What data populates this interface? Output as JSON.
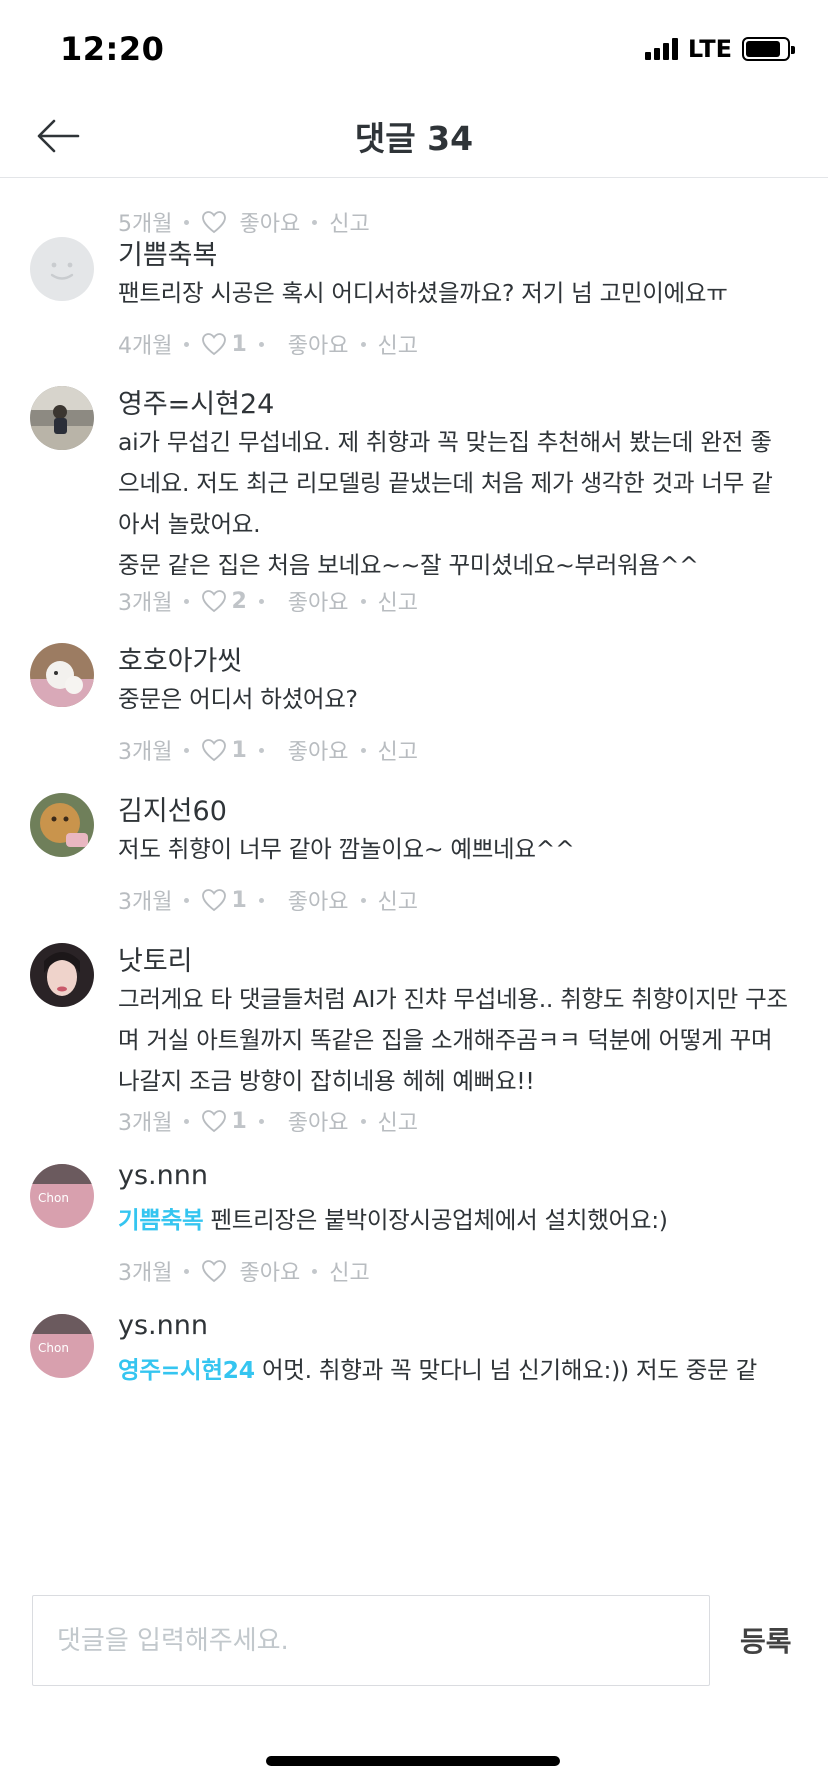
{
  "status_bar": {
    "time": "12:20",
    "network": "LTE"
  },
  "header": {
    "title": "댓글 34",
    "back_icon": "arrow-left-icon"
  },
  "labels": {
    "like": "좋아요",
    "report": "신고"
  },
  "top_meta": {
    "time": "5개월",
    "likes": ""
  },
  "comments": [
    {
      "username": "기쁨축복",
      "avatar": "default-face-avatar",
      "mention": "",
      "lines": [
        "팬트리장 시공은 혹시 어디서하셨을까요? 저기 넘 고민이에요ㅠ"
      ],
      "time": "4개월",
      "likes": "1"
    },
    {
      "username": "영주=시현24",
      "avatar": "photo-avatar",
      "mention": "",
      "lines": [
        "ai가 무섭긴 무섭네요. 제 취향과 꼭 맞는집 추천해서 봤는데 완전 좋으네요. 저도 최근 리모델링 끝냈는데 처음 제가 생각한 것과 너무 같아서 놀랐어요.",
        "중문 같은 집은 처음 보네요~~잘 꾸미셨네요~부러워욤^^"
      ],
      "time": "3개월",
      "likes": "2"
    },
    {
      "username": "호호아가씻",
      "avatar": "photo-avatar",
      "mention": "",
      "lines": [
        "중문은 어디서 하셨어요?"
      ],
      "time": "3개월",
      "likes": "1"
    },
    {
      "username": "김지선60",
      "avatar": "photo-avatar",
      "mention": "",
      "lines": [
        "저도 취향이 너무 같아 깜놀이요~ 예쁘네요^^"
      ],
      "time": "3개월",
      "likes": "1"
    },
    {
      "username": "낫토리",
      "avatar": "photo-avatar",
      "mention": "",
      "lines": [
        "그러게요 타 댓글들처럼 AI가 진챠 무섭네용.. 취향도 취향이지만 구조며 거실 아트월까지 똑같은 집을 소개해주곰ㅋㅋ 덕분에 어떻게 꾸며나갈지 조금 방향이 잡히네용 헤헤 예뻐요!!"
      ],
      "time": "3개월",
      "likes": "1"
    },
    {
      "username": "ys.nnn",
      "avatar": "photo-avatar",
      "mention": "기쁨축복",
      "lines": [
        "펜트리장은 붙박이장시공업체에서 설치했어요:)"
      ],
      "time": "3개월",
      "likes": ""
    },
    {
      "username": "ys.nnn",
      "avatar": "photo-avatar",
      "mention": "영주=시현24",
      "lines": [
        "어멋. 취향과 꼭 맞다니 넘 신기해요:)) 저도 중문 같"
      ],
      "time": "",
      "likes": ""
    }
  ],
  "input": {
    "placeholder": "댓글을 입력해주세요.",
    "value": "",
    "submit_label": "등록"
  },
  "colors": {
    "mention": "#35c5f0",
    "text": "#2f3438",
    "meta": "#b8bcc0",
    "divider": "#e3e5e8"
  }
}
